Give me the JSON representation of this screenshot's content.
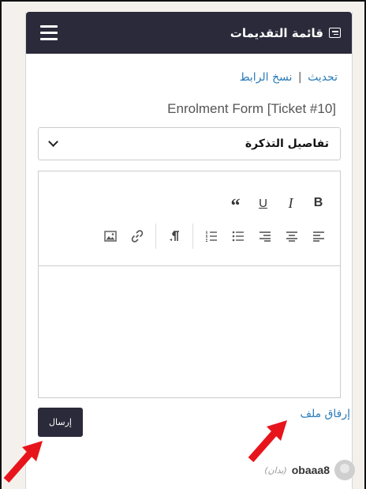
{
  "header": {
    "title": "قائمة التقديمات",
    "title_icon": "document-list-icon",
    "menu_icon": "hamburger-menu-icon"
  },
  "links": {
    "refresh": "تحديث",
    "separator": "|",
    "copy_link": "نسخ الرابط"
  },
  "form": {
    "title": "Enrolment Form [Ticket #10]"
  },
  "ticket_details_select": {
    "value": "تفاصيل التذكرة"
  },
  "toolbar": {
    "row1": [
      {
        "name": "bold-button",
        "label": "B"
      },
      {
        "name": "italic-button",
        "label": "I"
      },
      {
        "name": "underline-button",
        "label": "U"
      },
      {
        "name": "blockquote-button",
        "label": "“"
      }
    ],
    "row2_icons": [
      "align-left-icon",
      "align-center-icon",
      "align-right-icon",
      "bulleted-list-icon",
      "numbered-list-icon",
      "rtl-paragraph-icon",
      "link-icon",
      "image-icon"
    ]
  },
  "actions": {
    "attach_file": "إرفاق ملف",
    "send": "إرسال"
  },
  "comment": {
    "user": "obaaa8",
    "meta": "(بدان)"
  },
  "colors": {
    "header_bg": "#2b2a3a",
    "link": "#2b7bb9",
    "annotation_arrow": "#e8141b",
    "page_bg": "#f4f1ec"
  }
}
